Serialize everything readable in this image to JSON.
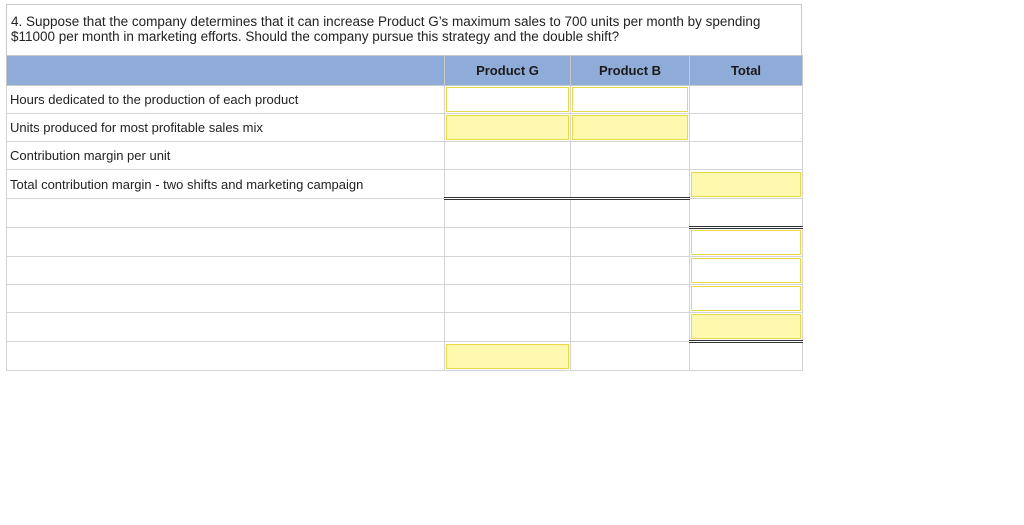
{
  "question": "4. Suppose that the company determines that it can increase Product G’s maximum sales to 700 units per month by spending $11000 per month in marketing efforts. Should the company pursue this strategy and the double shift?",
  "table": {
    "headers": [
      "",
      "Product G",
      "Product B",
      "Total"
    ],
    "row_labels": [
      "Hours dedicated to the production of each product",
      "Units produced for most profitable sales mix",
      "Contribution margin per unit",
      "Total contribution margin - two shifts and marketing campaign",
      "",
      "",
      "",
      "",
      "",
      ""
    ]
  },
  "colors": {
    "header_bg": "#8fabd8",
    "input_yellow": "#fff9b0",
    "input_border": "#e8d84a"
  }
}
